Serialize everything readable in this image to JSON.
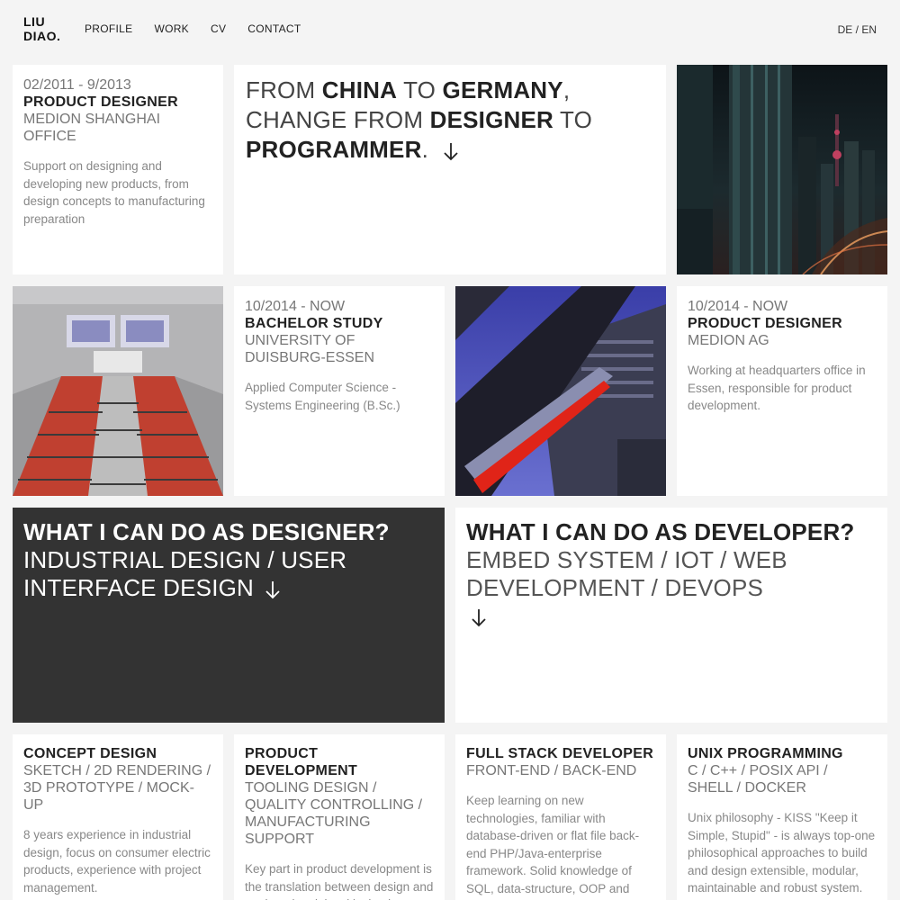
{
  "header": {
    "logo_line1": "LIU",
    "logo_line2": "DIAO.",
    "nav": [
      "PROFILE",
      "WORK",
      "CV",
      "CONTACT"
    ],
    "lang_de": "DE",
    "lang_sep": " / ",
    "lang_en": "EN"
  },
  "hero": {
    "parts": [
      "FROM ",
      "CHINA",
      " TO ",
      "GERMANY",
      ",",
      "CHANGE FROM ",
      "DESIGNER",
      " TO",
      "PROGRAMMER",
      "."
    ]
  },
  "cards": {
    "medion_shanghai": {
      "date": "02/2011 - 9/2013",
      "title": "PRODUCT DESIGNER",
      "sub": "MEDION SHANGHAI OFFICE",
      "desc": "Support on designing and developing new products, from design concepts to manufacturing preparation"
    },
    "bachelor": {
      "date": "10/2014 - NOW",
      "title": "BACHELOR STUDY",
      "sub": "UNIVERSITY OF DUISBURG-ESSEN",
      "desc": "Applied Computer Science - Systems Engineering (B.Sc.)"
    },
    "medion_ag": {
      "date": "10/2014 - NOW",
      "title": "PRODUCT DESIGNER",
      "sub": "MEDION AG",
      "desc": "Working at headquarters office in Essen, responsible for product development."
    },
    "designer": {
      "title": "WHAT I CAN DO AS DESIGNER?",
      "sub": "INDUSTRIAL DESIGN / USER INTERFACE DESIGN"
    },
    "developer": {
      "title": "WHAT I CAN DO AS DEVELOPER?",
      "sub": "EMBED SYSTEM / IOT / WEB DEVELOPMENT / DEVOPS"
    },
    "concept": {
      "title": "CONCEPT DESIGN",
      "sub": "SKETCH / 2D RENDERING / 3D PROTOTYPE / MOCK-UP",
      "desc": "8 years experience in industrial design, focus on consumer electric products, experience with project management."
    },
    "product_dev": {
      "title": "PRODUCT DEVELOPMENT",
      "sub": "TOOLING DESIGN / QUALITY CONTROLLING / MANUFACTURING SUPPORT",
      "desc": "Key part in product development is the translation between design and engineering, it is critical to keep original design identities when"
    },
    "fullstack": {
      "title": "FULL STACK DEVELOPER",
      "sub": "FRONT-END / BACK-END",
      "desc": "Keep learning on new technologies, familiar with database-driven or flat file back-end PHP/Java-enterprise framework. Solid knowledge of SQL, data-structure, OOP and network protocol, good practice in"
    },
    "unix": {
      "title": "UNIX PROGRAMMING",
      "sub": "C / C++ / POSIX API / SHELL / DOCKER",
      "desc": "Unix philosophy - KISS \"Keep it Simple, Stupid\" - is always top-one philosophical approaches to build and design extensible, modular, maintainable and robust system."
    }
  },
  "colors": {
    "background": "#f4f4f4",
    "card": "#ffffff",
    "dark_card": "#333333"
  }
}
